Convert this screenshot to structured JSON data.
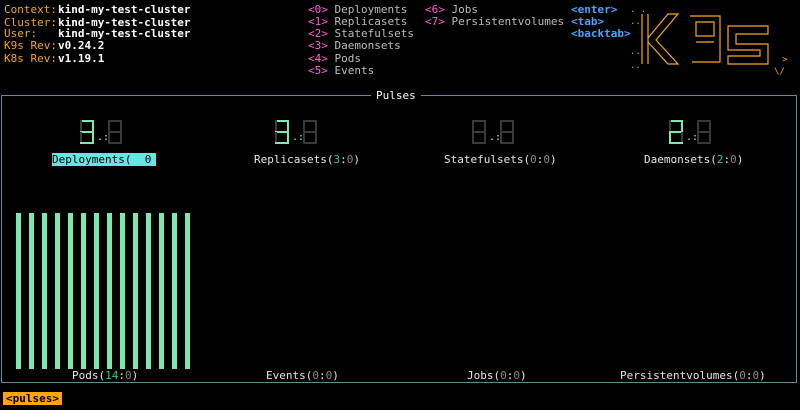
{
  "cluster_info": [
    {
      "key": "Context:",
      "value": "kind-my-test-cluster"
    },
    {
      "key": "Cluster:",
      "value": "kind-my-test-cluster"
    },
    {
      "key": "User:",
      "value": "kind-my-test-cluster"
    },
    {
      "key": "K9s Rev:",
      "value": "v0.24.2"
    },
    {
      "key": "K8s Rev:",
      "value": "v1.19.1"
    }
  ],
  "hotkeys_col1": [
    {
      "key": "<0>",
      "label": "Deployments"
    },
    {
      "key": "<1>",
      "label": "Replicasets"
    },
    {
      "key": "<2>",
      "label": "Statefulsets"
    },
    {
      "key": "<3>",
      "label": "Daemonsets"
    },
    {
      "key": "<4>",
      "label": "Pods"
    },
    {
      "key": "<5>",
      "label": "Events"
    }
  ],
  "hotkeys_col2": [
    {
      "key": "<6>",
      "label": "Jobs"
    },
    {
      "key": "<7>",
      "label": "Persistentvolumes"
    }
  ],
  "nav_keys": [
    "<enter>",
    "<tab>",
    "<backtab>"
  ],
  "panel_title": "Pulses",
  "gauges": [
    {
      "label": "Deployments(",
      "ok": "",
      "fault": "0",
      "suffix": "",
      "selected": true,
      "big_ok": 3,
      "big_fault": 0
    },
    {
      "label": "Replicasets(",
      "ok": "3",
      "fault": "0",
      "suffix": ")",
      "selected": false,
      "big_ok": 3,
      "big_fault": 0
    },
    {
      "label": "Statefulsets(",
      "ok": "0",
      "fault": "0",
      "suffix": ")",
      "selected": false,
      "big_ok": 0,
      "big_fault": 0
    },
    {
      "label": "Daemonsets(",
      "ok": "2",
      "fault": "0",
      "suffix": ")",
      "selected": false,
      "big_ok": 2,
      "big_fault": 0
    }
  ],
  "bottom_pulses": [
    {
      "label": "Pods(",
      "ok": "14",
      "fault": "0",
      "suffix": ")"
    },
    {
      "label": "Events(",
      "ok": "0",
      "fault": "0",
      "suffix": ")"
    },
    {
      "label": "Jobs(",
      "ok": "0",
      "fault": "0",
      "suffix": ")"
    },
    {
      "label": "Persistentvolumes(",
      "ok": "0",
      "fault": "0",
      "suffix": ")"
    }
  ],
  "pods_bar_count": 14,
  "breadcrumb": "<pulses>",
  "colors": {
    "accent": "#f5a623",
    "hotkey": "#ff5fd7",
    "ok": "#22d487",
    "bar": "#7de8ae",
    "selected": "#66e5e5",
    "border": "#5e8aa3"
  }
}
